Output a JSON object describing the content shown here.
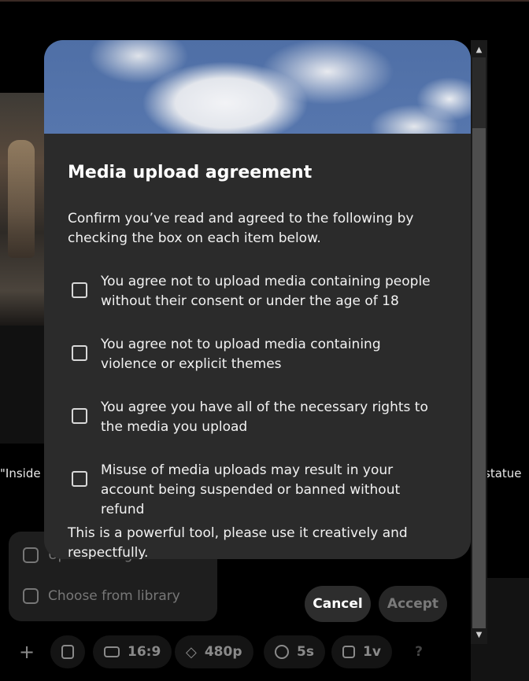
{
  "background": {
    "caption_left": "\"Inside",
    "caption_right": "statue"
  },
  "upload_menu": {
    "items": [
      {
        "label": "Upload image or video",
        "icon": "upload-media-icon"
      },
      {
        "label": "Choose from library",
        "icon": "library-icon"
      }
    ]
  },
  "toolbar": {
    "add_icon": "plus-icon",
    "prompt_icon": "book-icon",
    "aspect": {
      "label": "16:9",
      "icon": "aspect-ratio-icon"
    },
    "quality": {
      "label": "480p",
      "icon": "diamond-icon"
    },
    "duration": {
      "label": "5s",
      "icon": "clock-icon"
    },
    "variations": {
      "label": "1v",
      "icon": "frame-icon"
    },
    "help": "?"
  },
  "modal": {
    "title": "Media upload agreement",
    "intro": "Confirm you’ve read and agreed to the following by checking the box on each item below.",
    "items": [
      {
        "text": "You agree not to upload media containing people without their consent or under the age of 18",
        "checked": false
      },
      {
        "text": "You agree not to upload media containing violence or explicit themes",
        "checked": false
      },
      {
        "text": "You agree you have all of the necessary rights to the media you upload",
        "checked": false
      },
      {
        "text": "Misuse of media uploads may result in your account being suspended or banned without refund",
        "checked": false
      }
    ],
    "footer": "This is a powerful tool, please use it creatively and respectfully.",
    "cancel_label": "Cancel",
    "accept_label": "Accept"
  },
  "scrollbar": {
    "up": "▲",
    "down": "▼"
  }
}
